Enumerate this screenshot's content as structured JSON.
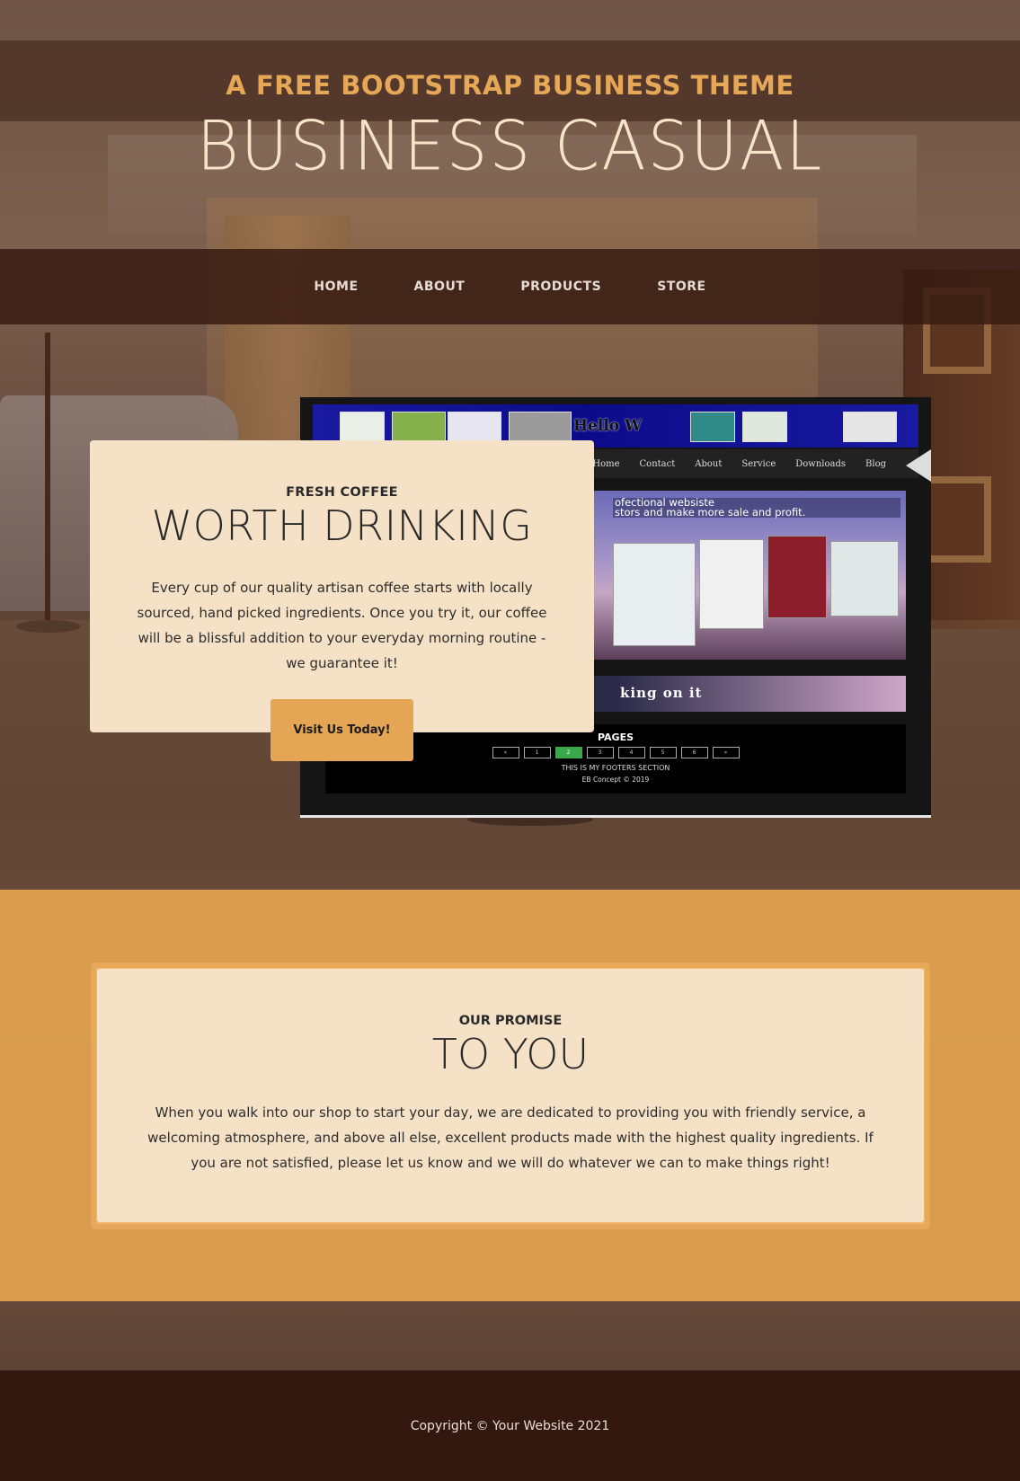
{
  "header": {
    "upper": "A FREE BOOTSTRAP BUSINESS THEME",
    "lower": "BUSINESS CASUAL"
  },
  "nav": {
    "items": [
      {
        "label": "HOME"
      },
      {
        "label": "ABOUT"
      },
      {
        "label": "PRODUCTS"
      },
      {
        "label": "STORE"
      }
    ]
  },
  "intro": {
    "upper": "FRESH COFFEE",
    "lower": "WORTH DRINKING",
    "body": "Every cup of our quality artisan coffee starts with locally sourced, hand picked ingredients. Once you try it, our coffee will be a blissful addition to your everyday morning routine - we guarantee it!",
    "button": "Visit Us Today!"
  },
  "mock_site": {
    "banner_title": "Hello W",
    "nav": [
      "Home",
      "Contact",
      "About",
      "Service",
      "Downloads",
      "Blog"
    ],
    "hero_line1": "ofectional websiste",
    "hero_line2": "stors and make more sale and profit.",
    "strip_text": "king on it",
    "footer_title": "PAGES",
    "pages": [
      "«",
      "1",
      "2",
      "3",
      "4",
      "5",
      "6",
      "»"
    ],
    "active_page": "2",
    "footer_note": "THIS IS MY FOOTERS SECTION",
    "footer_copy": "EB Concept © 2019"
  },
  "promise": {
    "upper": "OUR PROMISE",
    "lower": "TO YOU",
    "body": "When you walk into our shop to start your day, we are dedicated to providing you with friendly service, a welcoming atmosphere, and above all else, excellent products made with the highest quality ingredients. If you are not satisfied, please let us know and we will do whatever we can to make things right!"
  },
  "footer": {
    "text": "Copyright © Your Website 2021"
  },
  "colors": {
    "accent": "#e6a756",
    "header_text": "#f7e4c8",
    "card_bg": "#f5e1c5",
    "nav_bg": "#37170f",
    "footer_bg": "#33180f",
    "button_bg": "#e4a655"
  }
}
